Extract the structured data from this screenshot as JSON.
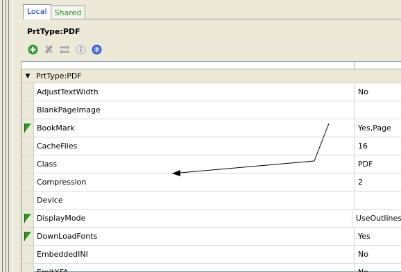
{
  "tabs": {
    "local": "Local",
    "shared": "Shared"
  },
  "object_title": "PrtType:PDF",
  "toolbar": {
    "icons": [
      "add-icon",
      "delete-icon",
      "move-icon",
      "info-icon",
      "help-icon"
    ],
    "colors": {
      "add": "#2e9b2e",
      "delete": "#9a9a9a",
      "help": "#3355cc"
    }
  },
  "grid": {
    "group_label": "PrtType:PDF",
    "rows": [
      {
        "name": "AdjustTextWidth",
        "value": "No",
        "flag": false
      },
      {
        "name": "BlankPageImage",
        "value": "",
        "flag": false
      },
      {
        "name": "BookMark",
        "value": "Yes,Page",
        "flag": true
      },
      {
        "name": "CacheFiles",
        "value": "16",
        "flag": false
      },
      {
        "name": "Class",
        "value": "PDF",
        "flag": false
      },
      {
        "name": "Compression",
        "value": "2",
        "flag": false
      },
      {
        "name": "Device",
        "value": "",
        "flag": false
      },
      {
        "name": "DisplayMode",
        "value": "UseOutlines",
        "flag": true
      },
      {
        "name": "DownLoadFonts",
        "value": "Yes",
        "flag": true
      },
      {
        "name": "EmbeddedINI",
        "value": "No",
        "flag": false
      },
      {
        "name": "EmitXFA",
        "value": "No",
        "flag": false
      }
    ],
    "flag_color": "#1ea01e"
  }
}
